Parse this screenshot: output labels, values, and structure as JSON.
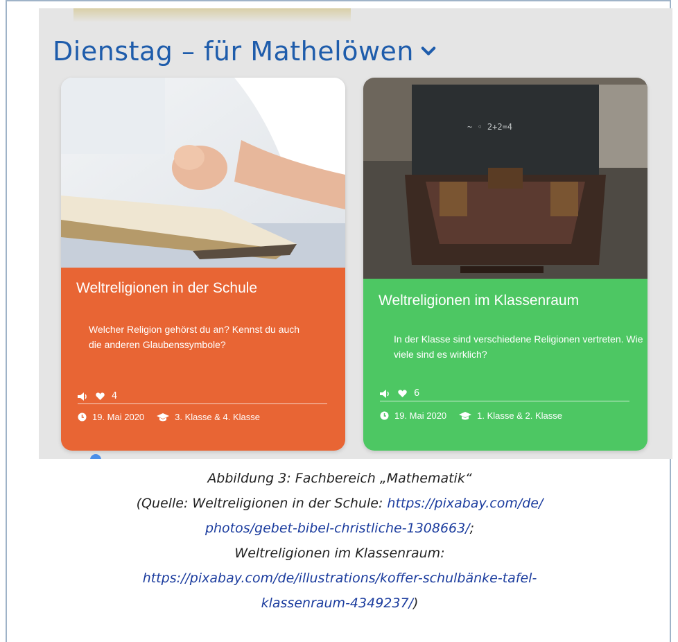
{
  "section": {
    "heading": "Dienstag – für Mathelöwen"
  },
  "cards": [
    {
      "title": "Weltreligionen in der Schule",
      "description": "Welcher Religion gehörst du an? Kennst du auch die anderen Glaubenssymbole?",
      "likes": "4",
      "date": "19. Mai 2020",
      "grades": "3. Klasse & 4. Klasse",
      "color": "#e86534"
    },
    {
      "title": "Weltreligionen im Klassenraum",
      "description": "In der Klasse sind verschiedene Religionen vertreten. Wie viele sind es wirklich?",
      "likes": "6",
      "date": "19. Mai 2020",
      "grades": "1. Klasse & 2. Klasse",
      "color": "#4dc763"
    }
  ],
  "caption": {
    "line1": "Abbildung 3: Fachbereich „Mathematik“",
    "line2_prefix": "(Quelle: Weltreligionen in der Schule: ",
    "link1a": "https://pixabay.com/de/",
    "link1b": "photos/gebet-bibel-christliche-1308663/",
    "line3_suffix": ";",
    "line4": "Weltreligionen im Klassenraum:",
    "link2a": "https://pixabay.com/de/illustrations/koffer-schulbänke-tafel-",
    "link2b": "klassenraum-4349237/",
    "closing": ")"
  }
}
